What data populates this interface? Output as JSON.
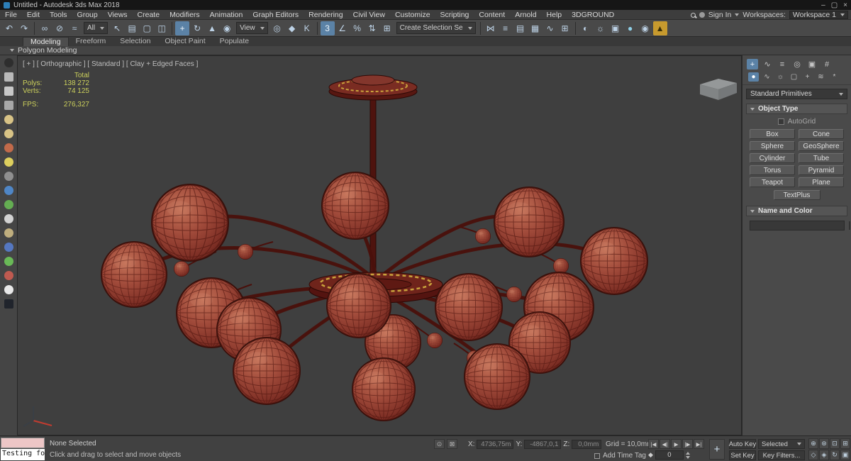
{
  "title_bar": {
    "title": "Untitled - Autodesk 3ds Max 2018",
    "minimize": "–",
    "maximize": "▢",
    "close": "×"
  },
  "menu": {
    "items": [
      {
        "name": "menu-file",
        "label": "File"
      },
      {
        "name": "menu-edit",
        "label": "Edit"
      },
      {
        "name": "menu-tools",
        "label": "Tools"
      },
      {
        "name": "menu-group",
        "label": "Group"
      },
      {
        "name": "menu-views",
        "label": "Views"
      },
      {
        "name": "menu-create",
        "label": "Create"
      },
      {
        "name": "menu-modifiers",
        "label": "Modifiers"
      },
      {
        "name": "menu-animation",
        "label": "Animation"
      },
      {
        "name": "menu-graph-editors",
        "label": "Graph Editors"
      },
      {
        "name": "menu-rendering",
        "label": "Rendering"
      },
      {
        "name": "menu-civil-view",
        "label": "Civil View"
      },
      {
        "name": "menu-customize",
        "label": "Customize"
      },
      {
        "name": "menu-scripting",
        "label": "Scripting"
      },
      {
        "name": "menu-content",
        "label": "Content"
      },
      {
        "name": "menu-arnold",
        "label": "Arnold"
      },
      {
        "name": "menu-help",
        "label": "Help"
      },
      {
        "name": "menu-3dground",
        "label": "3DGROUND"
      }
    ],
    "sign_in": "Sign In",
    "workspaces_label": "Workspaces:",
    "workspace_value": "Workspace 1"
  },
  "toolbar": {
    "g1": [
      {
        "name": "undo-icon",
        "glyph": "↶"
      },
      {
        "name": "redo-icon",
        "glyph": "↷"
      }
    ],
    "g2": [
      {
        "name": "select-and-link-icon",
        "glyph": "∞"
      },
      {
        "name": "unlink-selection-icon",
        "glyph": "⊘"
      },
      {
        "name": "bind-to-space-warp-icon",
        "glyph": "≈"
      }
    ],
    "filter_value": "All",
    "g3": [
      {
        "name": "select-object-icon",
        "glyph": "↖"
      },
      {
        "name": "select-by-name-icon",
        "glyph": "▤"
      },
      {
        "name": "rectangular-selection-region-icon",
        "glyph": "▢"
      },
      {
        "name": "window-crossing-toggle-icon",
        "glyph": "◫"
      }
    ],
    "g4": [
      {
        "name": "select-and-move-icon",
        "glyph": "+",
        "bg": "#5b82a6",
        "fg": "#eef5fb"
      },
      {
        "name": "select-and-rotate-icon",
        "glyph": "↻"
      },
      {
        "name": "select-and-scale-icon",
        "glyph": "▲"
      },
      {
        "name": "select-and-place-icon",
        "glyph": "◉"
      }
    ],
    "view_value": "View",
    "g5": [
      {
        "name": "use-pivot-point-center-icon",
        "glyph": "◎"
      },
      {
        "name": "select-and-manipulate-icon",
        "glyph": "◆"
      },
      {
        "name": "keyboard-shortcut-override-icon",
        "glyph": "K"
      }
    ],
    "g6": [
      {
        "name": "snaps-toggle-3d-icon",
        "glyph": "3",
        "bg": "#5b82a6",
        "fg": "#eef5fb"
      },
      {
        "name": "angle-snap-icon",
        "glyph": "∠"
      },
      {
        "name": "percent-snap-icon",
        "glyph": "%"
      },
      {
        "name": "spinner-snap-icon",
        "glyph": "⇅"
      }
    ],
    "g7": [
      {
        "name": "edit-named-selection-sets-icon",
        "glyph": "⊞"
      }
    ],
    "selection_set_value": "Create Selection Se",
    "g8": [
      {
        "name": "mirror-icon",
        "glyph": "⋈"
      },
      {
        "name": "align-icon",
        "glyph": "≡"
      },
      {
        "name": "layer-explorer-icon",
        "glyph": "▤"
      },
      {
        "name": "ribbon-toggle-icon",
        "glyph": "▦"
      },
      {
        "name": "curve-editor-icon",
        "glyph": "∿"
      },
      {
        "name": "schematic-view-icon",
        "glyph": "⊞"
      }
    ],
    "g9": [
      {
        "name": "material-editor-icon",
        "glyph": "◐"
      },
      {
        "name": "render-setup-icon",
        "glyph": "☼"
      },
      {
        "name": "rendered-frame-window-icon",
        "glyph": "▣"
      },
      {
        "name": "render-production-icon",
        "glyph": "●",
        "fg": "#8fd0e8"
      },
      {
        "name": "render-iterative-icon",
        "glyph": "◉"
      },
      {
        "name": "cloud-render-icon",
        "glyph": "▲",
        "bg": "#c79a2e",
        "fg": "#3a2f08"
      }
    ]
  },
  "ribbon": {
    "tabs": [
      {
        "name": "tab-modeling",
        "label": "Modeling",
        "active": true
      },
      {
        "name": "tab-freeform",
        "label": "Freeform"
      },
      {
        "name": "tab-selection",
        "label": "Selection"
      },
      {
        "name": "tab-object-paint",
        "label": "Object Paint"
      },
      {
        "name": "tab-populate",
        "label": "Populate"
      }
    ],
    "poly_label": "Polygon Modeling"
  },
  "left_strip": [
    {
      "name": "custom-tool-icon",
      "color": "#2e2e2e",
      "shape": "50%"
    },
    {
      "name": "custom-tool-icon",
      "color": "#b9b9b9",
      "shape": "2px"
    },
    {
      "name": "custom-tool-icon",
      "color": "#c8c8c8",
      "shape": "2px"
    },
    {
      "name": "custom-tool-icon",
      "color": "#a8a8a8",
      "shape": "2px"
    },
    {
      "name": "custom-tool-icon",
      "color": "#d8c386",
      "shape": "50%"
    },
    {
      "name": "custom-tool-icon",
      "color": "#d8c386",
      "shape": "50%"
    },
    {
      "name": "custom-tool-icon",
      "color": "#c26a4a",
      "shape": "50%"
    },
    {
      "name": "custom-tool-icon",
      "color": "#ddcf5e",
      "shape": "50%"
    },
    {
      "name": "custom-tool-icon",
      "color": "#8f8f8f",
      "shape": "50%"
    },
    {
      "name": "custom-tool-icon",
      "color": "#4f86c6",
      "shape": "50%"
    },
    {
      "name": "custom-tool-icon",
      "color": "#64ad52",
      "shape": "50%"
    },
    {
      "name": "custom-tool-icon",
      "color": "#d2d2d2",
      "shape": "50%"
    },
    {
      "name": "custom-tool-icon",
      "color": "#bfae7e",
      "shape": "50%"
    },
    {
      "name": "custom-tool-icon",
      "color": "#5577c0",
      "shape": "50%"
    },
    {
      "name": "custom-tool-icon",
      "color": "#69b957",
      "shape": "50%"
    },
    {
      "name": "custom-tool-icon",
      "color": "#bf5a50",
      "shape": "50%"
    },
    {
      "name": "custom-tool-icon",
      "color": "#e8e8e8",
      "shape": "50%"
    },
    {
      "name": "custom-tool-icon",
      "color": "#20242c",
      "shape": "2px"
    }
  ],
  "viewport": {
    "label": "[ + ] [ Orthographic ] [ Standard ] [ Clay + Edged Faces ]",
    "stats": {
      "header": "Total",
      "rows": [
        {
          "label": "Polys:",
          "value": "138 272"
        },
        {
          "label": "Verts:",
          "value": "74 125"
        }
      ],
      "fps_label": "FPS:",
      "fps_value": "276,327"
    }
  },
  "panel": {
    "tabs": [
      {
        "name": "create-tab-icon",
        "glyph": "+",
        "active": true
      },
      {
        "name": "modify-tab-icon",
        "glyph": "∿"
      },
      {
        "name": "hierarchy-tab-icon",
        "glyph": "≡"
      },
      {
        "name": "motion-tab-icon",
        "glyph": "◎"
      },
      {
        "name": "display-tab-icon",
        "glyph": "▣"
      },
      {
        "name": "utilities-tab-icon",
        "glyph": "#"
      }
    ],
    "categories": [
      {
        "name": "geometry-category-icon",
        "glyph": "●",
        "active": true
      },
      {
        "name": "shapes-category-icon",
        "glyph": "∿"
      },
      {
        "name": "lights-category-icon",
        "glyph": "☼"
      },
      {
        "name": "cameras-category-icon",
        "glyph": "▢"
      },
      {
        "name": "helpers-category-icon",
        "glyph": "+"
      },
      {
        "name": "space-warps-category-icon",
        "glyph": "≋"
      },
      {
        "name": "systems-category-icon",
        "glyph": "*"
      }
    ],
    "dropdown_value": "Standard Primitives",
    "object_type": {
      "title": "Object Type",
      "autogrid_label": "AutoGrid",
      "buttons": [
        "Box",
        "Cone",
        "Sphere",
        "GeoSphere",
        "Cylinder",
        "Tube",
        "Torus",
        "Pyramid",
        "Teapot",
        "Plane"
      ],
      "textplus": "TextPlus"
    },
    "name_and_color": {
      "title": "Name and Color",
      "name_value": "",
      "swatch_color": "#a6adb5"
    }
  },
  "status": {
    "maxscript_text": "Testing for i",
    "selection": "None Selected",
    "prompt": "Click and drag to select and move objects",
    "mid_icons": [
      {
        "name": "isolate-selection-icon",
        "glyph": "⊙"
      },
      {
        "name": "selection-lock-toggle-icon",
        "glyph": "⊠"
      }
    ],
    "coords": {
      "x_label": "X:",
      "x_value": "4736,75m",
      "y_label": "Y:",
      "y_value": "-4867,0,1",
      "z_label": "Z:",
      "z_value": "0,0mm"
    },
    "grid_label": "Grid = 10,0mm",
    "add_time_tag": "Add Time Tag",
    "playback": [
      {
        "name": "go-to-start-button",
        "glyph": "|◀"
      },
      {
        "name": "previous-frame-button",
        "glyph": "◀|"
      },
      {
        "name": "play-button",
        "glyph": "▶"
      },
      {
        "name": "next-frame-button",
        "glyph": "|▶"
      },
      {
        "name": "go-to-end-button",
        "glyph": "▶|"
      }
    ],
    "key_mode_glyph": "◆",
    "frame_value": "0",
    "set_keys_glyph": "+",
    "auto_key": "Auto Key",
    "set_key": "Set Key",
    "selected_dropdown": "Selected",
    "key_filters": "Key Filters...",
    "nav": [
      {
        "name": "zoom-icon",
        "glyph": "⊕"
      },
      {
        "name": "zoom-all-icon",
        "glyph": "⊛"
      },
      {
        "name": "zoom-extents-icon",
        "glyph": "⊡"
      },
      {
        "name": "zoom-extents-all-icon",
        "glyph": "⊞"
      },
      {
        "name": "field-of-view-icon",
        "glyph": "◇"
      },
      {
        "name": "pan-icon",
        "glyph": "◈"
      },
      {
        "name": "orbit-icon",
        "glyph": "↻"
      },
      {
        "name": "maximize-viewport-toggle-icon",
        "glyph": "▣"
      }
    ]
  }
}
